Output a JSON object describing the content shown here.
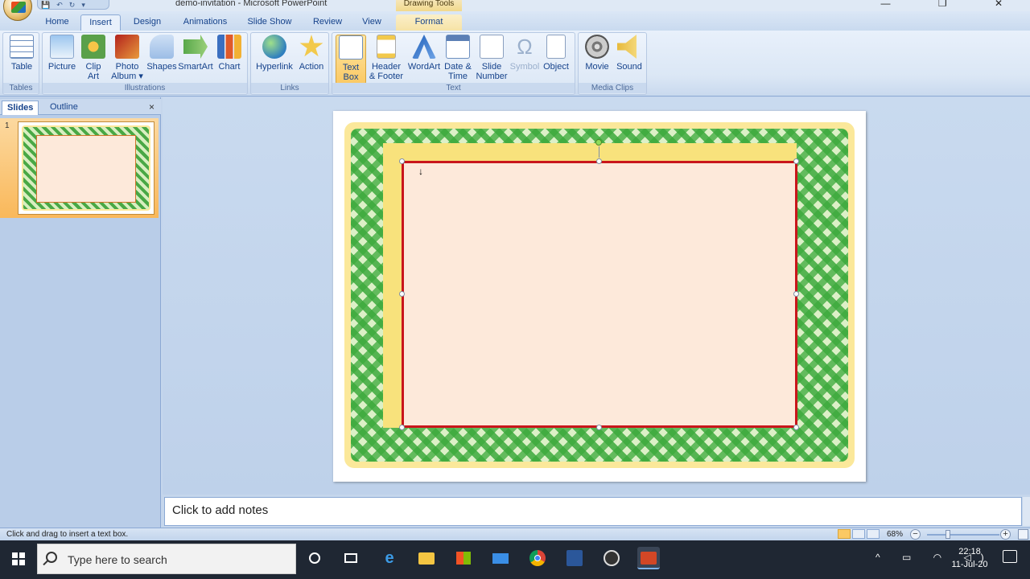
{
  "window": {
    "title": "demo-invitation - Microsoft PowerPoint",
    "context_tab_header": "Drawing Tools",
    "controls": "—  ❐  ✕"
  },
  "qat": {
    "save": "💾",
    "undo": "↶",
    "redo": "↻",
    "more": "▾"
  },
  "tabs": [
    "Home",
    "Insert",
    "Design",
    "Animations",
    "Slide Show",
    "Review",
    "View",
    "Format"
  ],
  "active_tab": "Insert",
  "ribbon": {
    "groups": {
      "tables": "Tables",
      "illustrations": "Illustrations",
      "links": "Links",
      "text": "Text",
      "media": "Media Clips"
    },
    "buttons": {
      "table": "Table",
      "picture": "Picture",
      "clip_art": "Clip Art",
      "photo_album": "Photo Album ▾",
      "shapes": "Shapes",
      "smartart": "SmartArt",
      "chart": "Chart",
      "hyperlink": "Hyperlink",
      "action": "Action",
      "text_box": "Text Box",
      "header_footer": "Header & Footer",
      "wordart": "WordArt",
      "date_time": "Date & Time",
      "slide_number": "Slide Number",
      "symbol": "Symbol",
      "object": "Object",
      "movie": "Movie",
      "sound": "Sound"
    }
  },
  "slide_pane": {
    "tab_slides": "Slides",
    "tab_outline": "Outline",
    "close": "×",
    "slide_number": "1"
  },
  "cursor_glyph": "↓",
  "notes": {
    "placeholder": "Click to add notes"
  },
  "status": {
    "message": "Click and drag to insert a text box.",
    "zoom": "68%",
    "zoom_minus": "−",
    "zoom_plus": "+"
  },
  "taskbar": {
    "search_placeholder": "Type here to search",
    "time": "22:18",
    "date": "11-Jul-20"
  },
  "colors": {
    "textbox_border": "#c9161b",
    "textbox_fill": "#fde9da",
    "ribbon_active": "#fbc964"
  }
}
